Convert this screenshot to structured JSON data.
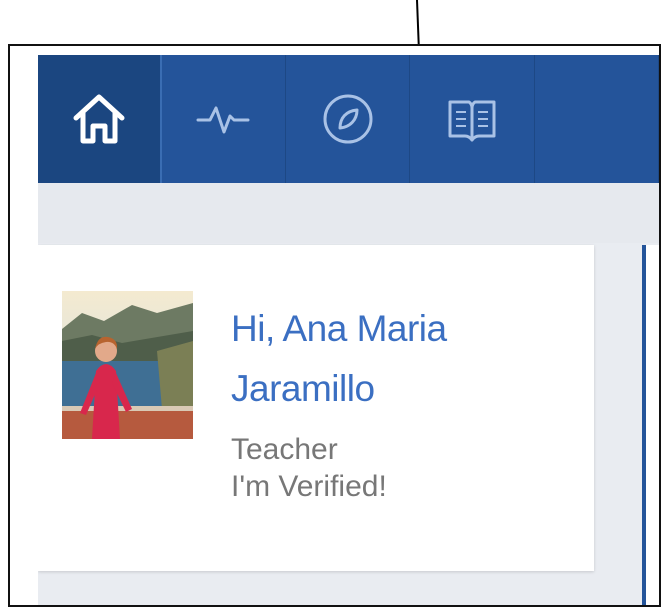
{
  "nav": {
    "items": [
      {
        "icon": "home-icon",
        "active": true
      },
      {
        "icon": "activity-pulse-icon",
        "active": false
      },
      {
        "icon": "compass-icon",
        "active": false
      },
      {
        "icon": "book-icon",
        "active": false
      }
    ]
  },
  "profile": {
    "greeting": "Hi, Ana Maria Jaramillo",
    "role": "Teacher",
    "status": "I'm Verified!"
  },
  "colors": {
    "navbar": "#24549a",
    "nav_active": "#1b4680",
    "greeting_text": "#3b6fc2",
    "muted_text": "#777777",
    "page_bg": "#e9ecf1"
  }
}
